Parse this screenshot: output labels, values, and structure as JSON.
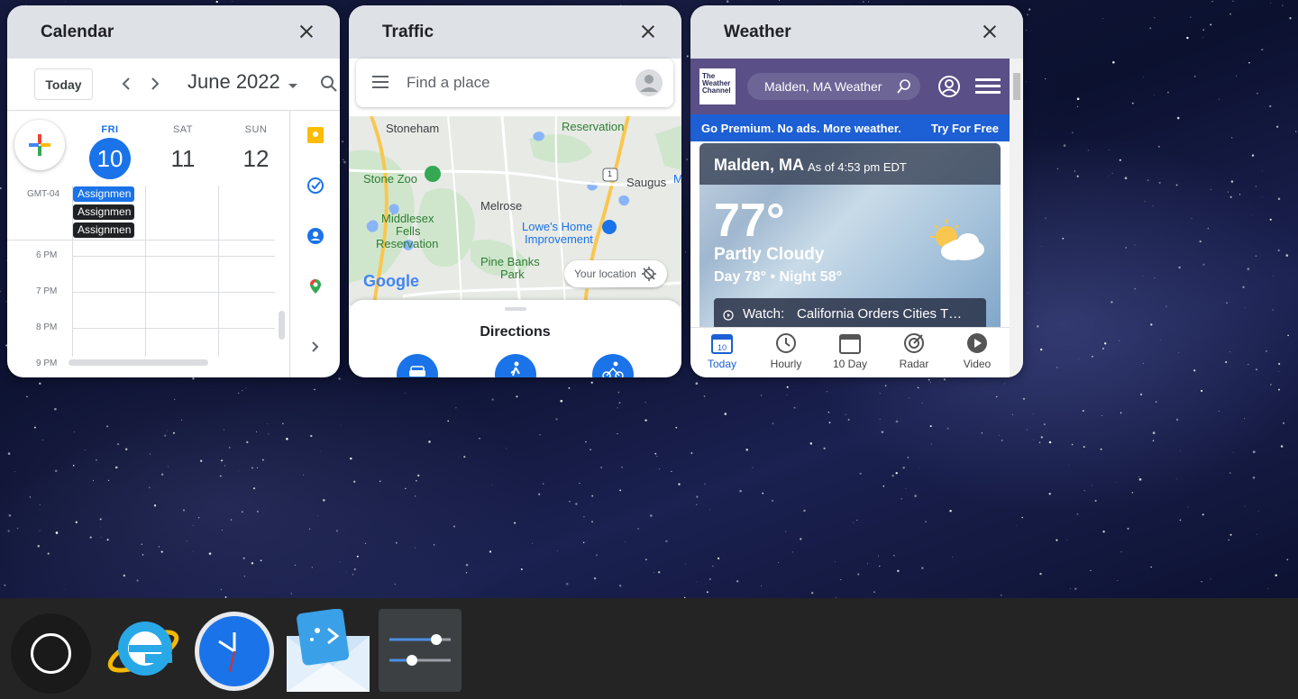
{
  "windows": {
    "calendar": {
      "title": "Calendar",
      "today_button": "Today",
      "month": "June 2022",
      "days": [
        {
          "name": "FRI",
          "num": "10",
          "today": true
        },
        {
          "name": "SAT",
          "num": "11"
        },
        {
          "name": "SUN",
          "num": "12"
        }
      ],
      "timezone": "GMT-04",
      "events": [
        "Assignmen",
        "Assignmen",
        "Assignmen"
      ],
      "hours": [
        "6 PM",
        "7 PM",
        "8 PM",
        "9 PM"
      ]
    },
    "traffic": {
      "title": "Traffic",
      "search_placeholder": "Find a place",
      "map_labels": {
        "stoneham": "Stoneham",
        "reservation_top": "Reservation",
        "stone_zoo": "Stone Zoo",
        "saugus": "Saugus",
        "route": "1",
        "melrose": "Melrose",
        "middlesex": "Middlesex",
        "fells": "Fells",
        "reservation": "Reservation",
        "lowes_1": "Lowe's Home",
        "lowes_2": "Improvement",
        "pine_banks_1": "Pine Banks",
        "pine_banks_2": "Park",
        "google": "Google",
        "edge_m": "M"
      },
      "your_location": "Your location",
      "directions_title": "Directions"
    },
    "weather": {
      "title": "Weather",
      "logo_lines": [
        "The",
        "Weather",
        "Channel"
      ],
      "search_text": "Malden, MA Weather",
      "promo_text": "Go Premium. No ads. More weather.",
      "promo_cta": "Try For Free",
      "location": "Malden, MA",
      "as_of": "As of 4:53 pm EDT",
      "temperature": "77°",
      "condition": "Partly Cloudy",
      "day_night": "Day 78° • Night 58°",
      "watch_label": "Watch:",
      "watch_text": "California Orders Cities T…",
      "nav": [
        {
          "label": "Today",
          "icon": "calendar-icon",
          "badge": "10"
        },
        {
          "label": "Hourly",
          "icon": "clock-icon"
        },
        {
          "label": "10 Day",
          "icon": "calendar-icon"
        },
        {
          "label": "Radar",
          "icon": "radar-icon"
        },
        {
          "label": "Video",
          "icon": "play-icon"
        }
      ]
    }
  },
  "shelf": {
    "apps": [
      "internet-explorer-icon",
      "clock-app-icon",
      "mail-app-icon",
      "settings-sliders-icon"
    ]
  },
  "colors": {
    "calendar_blue": "#1a73e8",
    "weather_purple": "#5a4f86",
    "weather_promo": "#1d5fd4",
    "shelf": "#242424"
  }
}
